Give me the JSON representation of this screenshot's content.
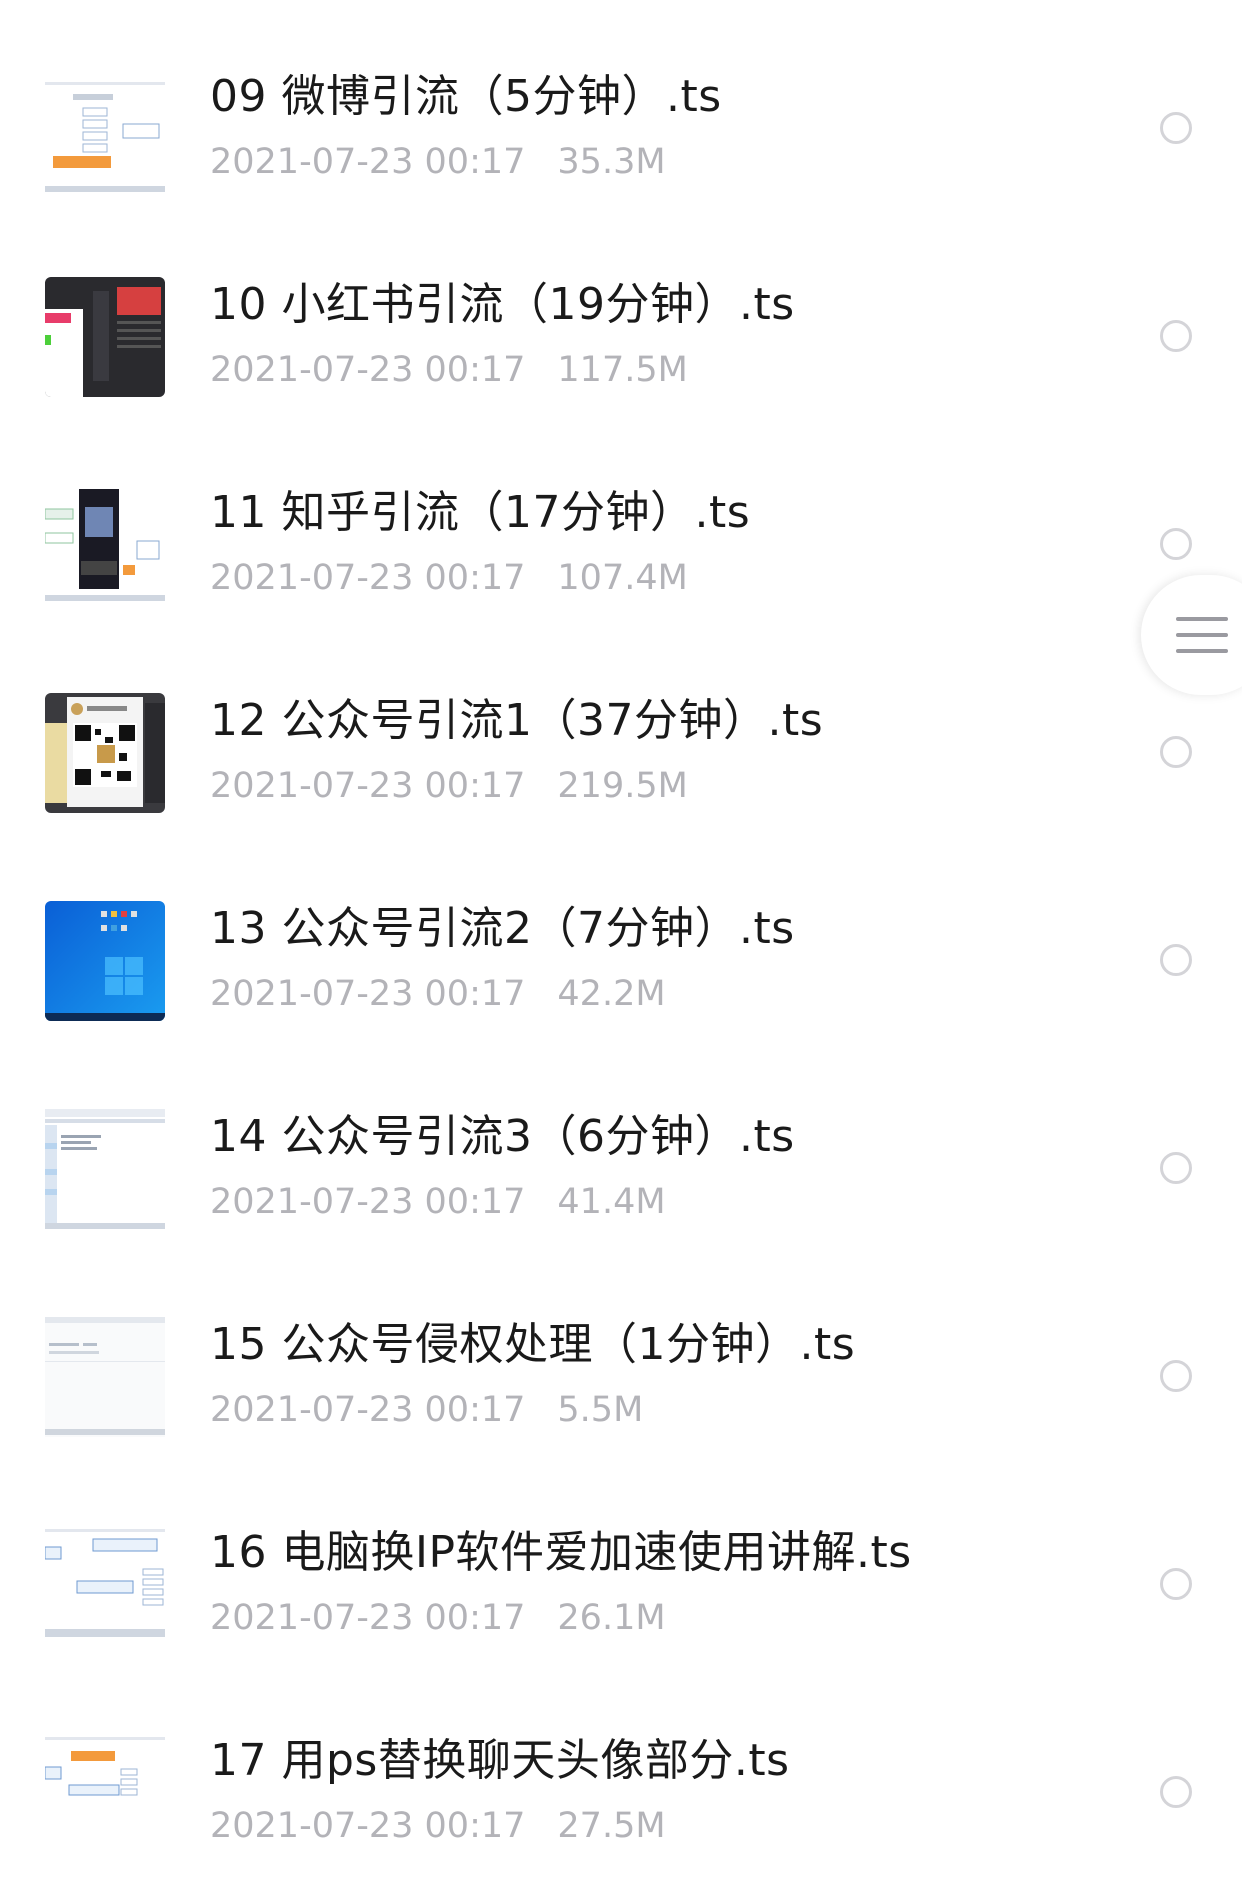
{
  "files": [
    {
      "title": "09 微博引流（5分钟）.ts",
      "date": "2021-07-23 00:17",
      "size": "35.3M",
      "thumb": "mindmap-orange-icon"
    },
    {
      "title": "10 小红书引流（19分钟）.ts",
      "date": "2021-07-23 00:17",
      "size": "117.5M",
      "thumb": "photoshop-dark-icon"
    },
    {
      "title": "11 知乎引流（17分钟）.ts",
      "date": "2021-07-23 00:17",
      "size": "107.4M",
      "thumb": "video-mindmap-icon"
    },
    {
      "title": "12 公众号引流1（37分钟）.ts",
      "date": "2021-07-23 00:17",
      "size": "219.5M",
      "thumb": "qrcode-icon"
    },
    {
      "title": "13 公众号引流2（7分钟）.ts",
      "date": "2021-07-23 00:17",
      "size": "42.2M",
      "thumb": "windows-desktop-icon"
    },
    {
      "title": "14 公众号引流3（6分钟）.ts",
      "date": "2021-07-23 00:17",
      "size": "41.4M",
      "thumb": "spreadsheet-icon"
    },
    {
      "title": "15 公众号侵权处理（1分钟）.ts",
      "date": "2021-07-23 00:17",
      "size": "5.5M",
      "thumb": "webpage-icon"
    },
    {
      "title": "16 电脑换IP软件爱加速使用讲解.ts",
      "date": "2021-07-23 00:17",
      "size": "26.1M",
      "thumb": "mindmap-blue-icon"
    },
    {
      "title": "17 用ps替换聊天头像部分.ts",
      "date": "2021-07-23 00:17",
      "size": "27.5M",
      "thumb": "mindmap-orange-blue-icon"
    }
  ],
  "colors": {
    "title_text": "#1a1a1a",
    "meta_text": "#b3b3b8",
    "radio_border": "#d4d4d8"
  },
  "side_handle": {
    "icon": "menu-handle-icon"
  }
}
